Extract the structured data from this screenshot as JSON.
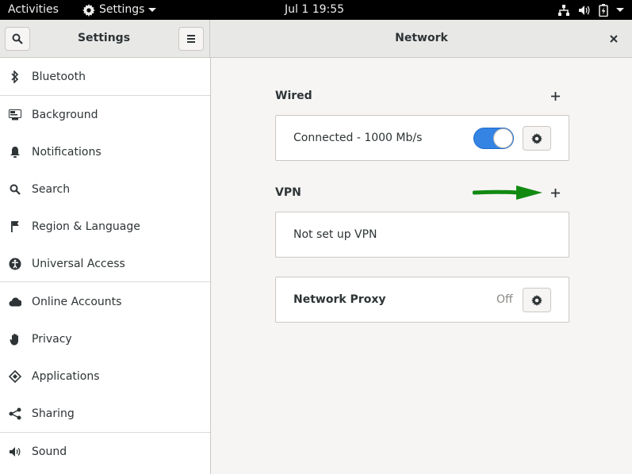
{
  "topbar": {
    "activities": "Activities",
    "app_name": "Settings",
    "clock": "Jul 1  19:55",
    "status_icons": [
      "network-icon",
      "volume-icon",
      "battery-icon",
      "chevron-down-icon"
    ]
  },
  "header": {
    "sidebar_title": "Settings",
    "main_title": "Network",
    "search_icon": "search-icon",
    "menu_icon": "hamburger-icon",
    "close_icon": "close-icon"
  },
  "sidebar": {
    "items": [
      {
        "label": "Bluetooth",
        "icon": "bluetooth-icon"
      },
      {
        "label": "Background",
        "icon": "background-icon"
      },
      {
        "label": "Notifications",
        "icon": "bell-icon"
      },
      {
        "label": "Search",
        "icon": "search-icon"
      },
      {
        "label": "Region & Language",
        "icon": "flag-icon"
      },
      {
        "label": "Universal Access",
        "icon": "accessibility-icon"
      },
      {
        "label": "Online Accounts",
        "icon": "cloud-icon"
      },
      {
        "label": "Privacy",
        "icon": "hand-icon"
      },
      {
        "label": "Applications",
        "icon": "applications-icon"
      },
      {
        "label": "Sharing",
        "icon": "share-icon"
      },
      {
        "label": "Sound",
        "icon": "speaker-icon"
      }
    ]
  },
  "network": {
    "wired": {
      "title": "Wired",
      "status": "Connected - 1000 Mb/s",
      "toggle_on": true
    },
    "vpn": {
      "title": "VPN",
      "empty_text": "Not set up VPN"
    },
    "proxy": {
      "title": "Network Proxy",
      "state": "Off"
    }
  },
  "colors": {
    "accent": "#3584e4",
    "annotation_arrow": "#128a12",
    "topbar": "#000000"
  }
}
